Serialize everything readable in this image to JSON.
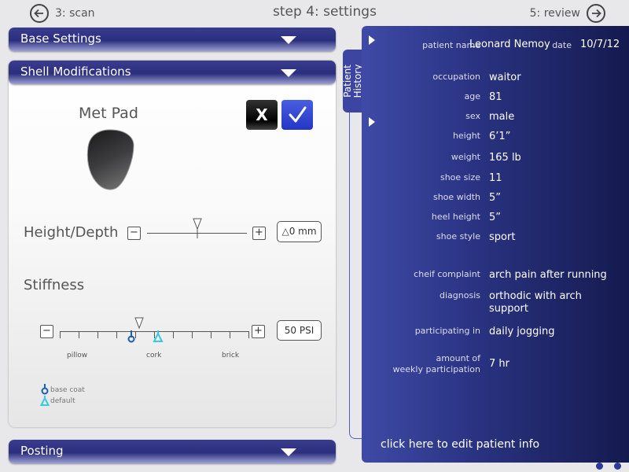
{
  "nav": {
    "prev_label": "3: scan",
    "title": "step 4: settings",
    "next_label": "5: review"
  },
  "sections": {
    "base_settings": "Base Settings",
    "shell_modifications": "Shell Modifications",
    "posting": "Posting"
  },
  "shell": {
    "pad_label": "Met Pad",
    "reject_label": "X",
    "height_label": "Height/Depth",
    "height_value": "0 mm",
    "height_level": 0.5,
    "stiffness_label": "Stiffness",
    "stiffness_value": "50 PSI",
    "stiffness_base_coat_level": 0.38,
    "stiffness_default_level": 0.42,
    "scale": [
      "pillow",
      "cork",
      "brick"
    ],
    "legend": [
      "base coat",
      "default"
    ],
    "minus": "−",
    "plus": "+"
  },
  "patient_history": {
    "tab_label_1": "Patient",
    "tab_label_2": "History",
    "name_label": "patient name",
    "name": "Leonard Nemoy",
    "date_label": "date",
    "date": "10/7/12",
    "fields": [
      {
        "k": "occupation",
        "v": "waitor"
      },
      {
        "k": "age",
        "v": "81"
      },
      {
        "k": "sex",
        "v": "male"
      },
      {
        "k": "height",
        "v": "6’1”"
      },
      {
        "k": "weight",
        "v": "165 lb"
      },
      {
        "k": "shoe size",
        "v": "11"
      },
      {
        "k": "shoe width",
        "v": "5”"
      },
      {
        "k": "heel height",
        "v": "5”"
      },
      {
        "k": "shoe style",
        "v": "sport"
      }
    ],
    "complaint_label": "cheif complaint",
    "complaint": "arch pain after running",
    "diagnosis_label": "diagnosis",
    "diagnosis_1": "orthodic with arch",
    "diagnosis_2": "support",
    "participating_label": "participating in",
    "participating": "daily jogging",
    "amount_label_1": "amount of",
    "amount_label_2": "weekly participation",
    "amount": "7 hr",
    "edit_label": "click here to edit patient info"
  },
  "colors": {
    "accent": "#2b2e7c",
    "check_blue": "#2436c6",
    "base_coat": "#1a5fb0",
    "default": "#3bc8e0"
  }
}
